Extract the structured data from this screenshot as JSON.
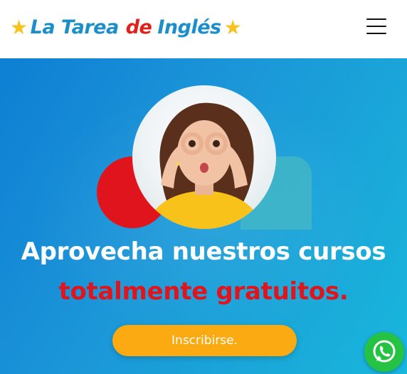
{
  "header": {
    "logo": {
      "star_left": "★",
      "part1": "La Tarea",
      "part2": "de",
      "part3": "Inglés",
      "star_right": "★"
    },
    "menu_icon": "hamburger-menu-icon"
  },
  "hero": {
    "headline_line1": "Aprovecha nuestros cursos",
    "headline_line2": "totalmente gratuitos.",
    "cta_label": "Inscribirse."
  },
  "floating": {
    "whatsapp_icon": "whatsapp-icon"
  },
  "colors": {
    "brand_blue": "#1c8ec9",
    "brand_red": "#e0211b",
    "star_yellow": "#f7c21b",
    "cta_orange": "#fbaa12",
    "hero_blue": "#1b95d8",
    "whatsapp_green": "#25c244"
  }
}
